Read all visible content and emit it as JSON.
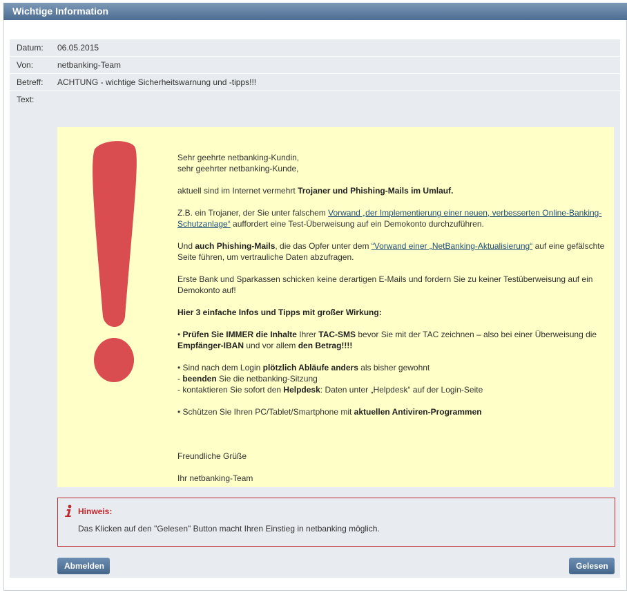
{
  "window": {
    "title": "Wichtige Information"
  },
  "meta": {
    "date_label": "Datum:",
    "date_value": "06.05.2015",
    "from_label": "Von:",
    "from_value": "netbanking-Team",
    "subject_label": "Betreff:",
    "subject_value": "ACHTUNG - wichtige Sicherheitswarnung und -tipps!!!",
    "text_label": "Text:"
  },
  "icons": {
    "warning": "exclamation-mark-icon",
    "info": "info-icon"
  },
  "colors": {
    "titlebar": "#5a7ca0",
    "content_bg": "#ffffc8",
    "exclamation": "#d94c4f",
    "hint_border": "#c0282d"
  },
  "message": {
    "greeting_1": "Sehr geehrte netbanking-Kundin,",
    "greeting_2": "sehr geehrter netbanking-Kunde,",
    "p1_pre": "aktuell sind im Internet vermehrt ",
    "p1_bold": "Trojaner und Phishing-Mails im Umlauf.",
    "p2_pre": "Z.B. ein Trojaner, der Sie unter falschem ",
    "p2_link": "Vorwand „der Implementierung einer neuen, verbesserten Online-Banking-Schutzanlage“",
    "p2_post": " auffordert eine Test-Überweisung auf ein Demokonto durchzuführen.",
    "p3_pre": "Und ",
    "p3_bold": "auch Phishing-Mails",
    "p3_mid": ", die das Opfer unter dem ",
    "p3_link": "“Vorwand einer „NetBanking-Aktualisierung“",
    "p3_post": " auf eine gefälschte Seite führen, um vertrauliche Daten abzufragen.",
    "p4": "Erste Bank und Sparkassen schicken keine derartigen E-Mails und fordern Sie zu keiner Testüberweisung auf ein Demokonto auf!",
    "p5_bold": "Hier 3 einfache Infos und Tipps mit großer Wirkung:",
    "tip1_pre": "• ",
    "tip1_bold1": "Prüfen Sie IMMER die Inhalte",
    "tip1_mid1": " Ihrer ",
    "tip1_bold2": "TAC-SMS",
    "tip1_mid2": " bevor Sie mit der TAC zeichnen – also bei einer Überweisung die ",
    "tip1_bold3": "Empfänger-IBAN",
    "tip1_mid3": " und vor allem ",
    "tip1_bold4": "den Betrag!!!!",
    "tip2_pre": "• Sind nach dem Login ",
    "tip2_bold": "plötzlich Abläufe anders",
    "tip2_post": " als bisher gewohnt",
    "tip2b_pre": "- ",
    "tip2b_bold": "beenden",
    "tip2b_post": " Sie die netbanking-Sitzung",
    "tip2c_pre": "- kontaktieren Sie sofort den ",
    "tip2c_bold": "Helpdesk",
    "tip2c_post": ": Daten unter „Helpdesk“ auf der Login-Seite",
    "tip3_pre": "• Schützen Sie Ihren PC/Tablet/Smartphone mit ",
    "tip3_bold": "aktuellen Antiviren-Programmen",
    "closing": "Freundliche Grüße",
    "signature": "Ihr netbanking-Team"
  },
  "hint": {
    "title": "Hinweis:",
    "text": "Das Klicken auf den \"Gelesen\" Button macht Ihren Einstieg in netbanking möglich."
  },
  "buttons": {
    "logout": "Abmelden",
    "read": "Gelesen"
  }
}
